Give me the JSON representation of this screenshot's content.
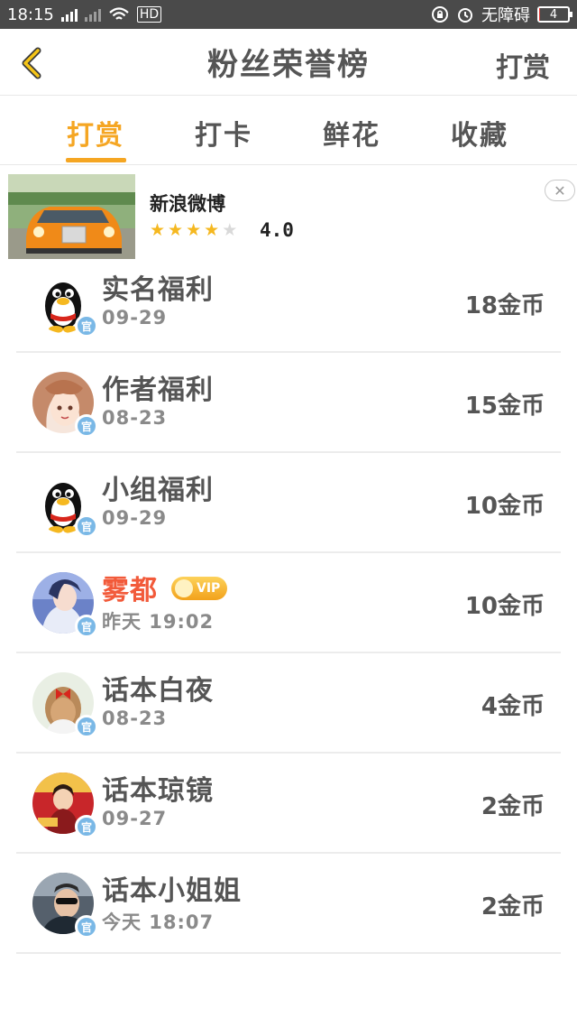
{
  "status_bar": {
    "time": "18:15",
    "network": "4G",
    "hd": "HD",
    "accessibility": "无障碍",
    "battery_level": "4",
    "battery_fraction": 0.04
  },
  "header": {
    "title": "粉丝荣誉榜",
    "action": "打赏"
  },
  "tabs": [
    {
      "label": "打赏",
      "active": true
    },
    {
      "label": "打卡",
      "active": false
    },
    {
      "label": "鲜花",
      "active": false
    },
    {
      "label": "收藏",
      "active": false
    }
  ],
  "ad": {
    "app_name": "新浪微博",
    "rating": "4.0",
    "stars": 4,
    "max_stars": 5
  },
  "ranking": [
    {
      "name": "实名福利",
      "date": "09-29",
      "amount": "18金币",
      "badge": "官",
      "avatar": "qq-penguin"
    },
    {
      "name": "作者福利",
      "date": "08-23",
      "amount": "15金币",
      "badge": "官",
      "avatar": "anime-girl"
    },
    {
      "name": "小组福利",
      "date": "09-29",
      "amount": "10金币",
      "badge": "官",
      "avatar": "qq-penguin"
    },
    {
      "name": "雾都",
      "date": "昨天 19:02",
      "amount": "10金币",
      "badge": "官",
      "avatar": "anime-boy",
      "vip": "VIP"
    },
    {
      "name": "话本白夜",
      "date": "08-23",
      "amount": "4金币",
      "badge": "官",
      "avatar": "girl-red-bow"
    },
    {
      "name": "话本琼镜",
      "date": "09-27",
      "amount": "2金币",
      "badge": "官",
      "avatar": "red-illustration"
    },
    {
      "name": "话本小姐姐",
      "date": "今天 18:07",
      "amount": "2金币",
      "badge": "官",
      "avatar": "sunglasses-man"
    }
  ],
  "colors": {
    "accent": "#f5a623",
    "vip_name": "#f25a3a",
    "status_bar": "#4a4a4a",
    "badge": "#7ab8e6"
  }
}
